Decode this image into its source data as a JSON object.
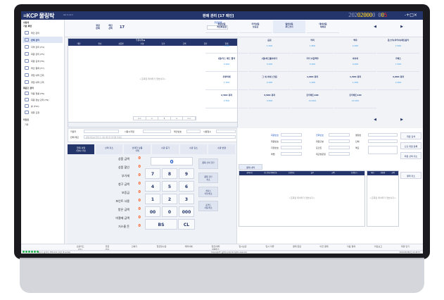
{
  "titlebar": {
    "logo": "≡KCP 물링탁",
    "version": "Ver 3.1.0.3",
    "title": "판매 관리 [17 레인]",
    "digits_dim": "202",
    "digits_yel1": "0",
    "digits_yel2": "2000",
    "digits_dim2": "0 0",
    "digits_yel3": "0",
    "digits_red": "5",
    "win_controls": "-+□×"
  },
  "sidebar": {
    "head1": "사용자",
    "head2": "기본 화면",
    "items": [
      "레인 관리",
      "판매 관리",
      "지역 관리 (F4)",
      "회원 관리 (F5)",
      "회원 검색 (F6)",
      "레인 결제 (F7)",
      "게임 내역 조회",
      "게임 내역 출력"
    ],
    "head3": "회원고 관리",
    "items2": [
      "적용 현황 (F8)",
      "회원 정보 관리 (F9)",
      "롤 (F10)",
      "대화 요청"
    ],
    "head4": "리포트",
    "items3": [
      "기타"
    ]
  },
  "topbar": {
    "b1": "정원\n판매",
    "b2": "레인\n선택",
    "lane_num": "17",
    "select_label": "주문화면"
  },
  "cart": {
    "header_title": "주문내역 ▶",
    "cols": [
      "레인",
      "번호",
      "상품명",
      "수량",
      "단가",
      "금액",
      "할인",
      "합계"
    ],
    "empty": "<조회된 데이터가 없습니다>",
    "pager": [
      "<<",
      "<",
      "1",
      ">",
      ">>"
    ]
  },
  "products": {
    "tabs": [
      "회원상품\n게임회원권",
      "리커상품\n보증금",
      "일반상품\n푸드코너",
      "대여상품\n대여료"
    ],
    "items": [
      {
        "name": "생수",
        "price": "1,000"
      },
      {
        "name": "음료",
        "price": "1,500"
      },
      {
        "name": "커피",
        "price": "1,800"
      },
      {
        "name": "맥주",
        "price": "2,000"
      },
      {
        "name": "폰스타(쿠키어)레트롬카",
        "price": "2,500"
      },
      {
        "name": "(캠)카스 레드 랩저",
        "price": "4,000"
      },
      {
        "name": "(캠)하드플사이다",
        "price": "3,000"
      },
      {
        "name": "가더 수입맥주",
        "price": "5,000"
      },
      {
        "name": "아사히",
        "price": "4,000"
      },
      {
        "name": "가래스",
        "price": "7,500"
      },
      {
        "name": "우루비세",
        "price": "1,500"
      },
      {
        "name": "그 외 아이스크림",
        "price": "2,000"
      },
      {
        "name": "1,000 과자",
        "price": "1,000"
      },
      {
        "name": "1,500 과자",
        "price": "1,500"
      },
      {
        "name": "2,000 과자",
        "price": "2,000"
      },
      {
        "name": "2,500 과자",
        "price": "2,500"
      },
      {
        "name": "3,500 과자",
        "price": "3,500"
      },
      {
        "name": "조리베드100",
        "price": "10,000"
      },
      {
        "name": "조리베드120",
        "price": "12,000"
      }
    ],
    "nav_prev": "◀",
    "nav_next": "▶"
  },
  "form": {
    "customer_label": "카운터",
    "customer_value": "",
    "user_label": "사용시작일",
    "lane_label": "레인번호",
    "date_label": "사용일수",
    "memo_label": "판매 메모",
    "memo_placeholder": "판매 메모를 입력 후 저장 버튼을 클릭해 주세요"
  },
  "ops": {
    "b1": "현재 선택\n(연속 1개)",
    "b2": "선택 취소",
    "b3": "선택한 상품\n삭제",
    "b4": "수량 증가",
    "b5": "수량 감소",
    "b6": "수량 변경"
  },
  "summary": [
    {
      "label": "상품 금액",
      "value": "0"
    },
    {
      "label": "상품 할인",
      "value": "0"
    },
    {
      "label": "부가세",
      "value": "0"
    },
    {
      "label": "청구 금액",
      "value": "0"
    },
    {
      "label": "보증금",
      "value": "0"
    },
    {
      "label": "포인트 사용",
      "value": "0"
    },
    {
      "label": "받은 금액",
      "value": "0"
    },
    {
      "label": "미결제 금액",
      "value": "0"
    },
    {
      "label": "거스름 돈",
      "value": "0"
    }
  ],
  "numpad": {
    "display": "0",
    "keys": [
      "7",
      "8",
      "9",
      "4",
      "5",
      "6",
      "1",
      "2",
      "3",
      "00",
      "0",
      "000",
      "BS",
      "CL"
    ],
    "side": [
      "품목 선택 할인",
      "품목 할인\n취소",
      "레지스\n적립/취소",
      "포인트\n사용/취소"
    ]
  },
  "right": {
    "member_no": "회원번호",
    "member_status": "전화번호",
    "member_name": "회원번호",
    "member_tel": "회원구분",
    "member_id": "지정번호",
    "member_grade": "포인트",
    "member_addr": "레벨",
    "member_etc": "최근방문일",
    "memo_label": "결정번",
    "phone_label": "단체",
    "note_label": "메모",
    "btn_search": "회원 검색",
    "btn_new": "신규 회원 등록",
    "btn_cancel": "회원 선택 취소",
    "pay_tab": "결제 내역",
    "pay_cols": [
      "결제수단",
      "카드번호/계좌번호",
      "승인번호",
      "할부",
      "금액",
      "승인일시"
    ],
    "pay_empty": "<조회된 데이터가 없습니다>",
    "pt_cols": [
      "레인",
      "상품명",
      "금액"
    ],
    "pt_empty": "<조회된 데이터가 없습니다>",
    "btn_pay_cancel": "결제 취소"
  },
  "bottom": {
    "b1": "신용카드\n(F1)",
    "b2": "현금\n(F2)",
    "b3": "인쇄기",
    "b4": "현금영수증",
    "b5": "계좌이체",
    "b6": "현금/계좌\n이체취소",
    "b7": "임시보관",
    "b8": "임시 리콜",
    "b9": "결제 완료",
    "b10": "이전 결제",
    "b11": "다음 결제",
    "b12": "마감보고",
    "b13": "화면 닫기"
  },
  "status": {
    "left": "제조사: 물링탁 | POS-121 | 버전 (6 series)",
    "center": "Copyright© 물링탁코리아 All rights reserved.",
    "right": "2024-08-08(목) 14:48:57"
  }
}
